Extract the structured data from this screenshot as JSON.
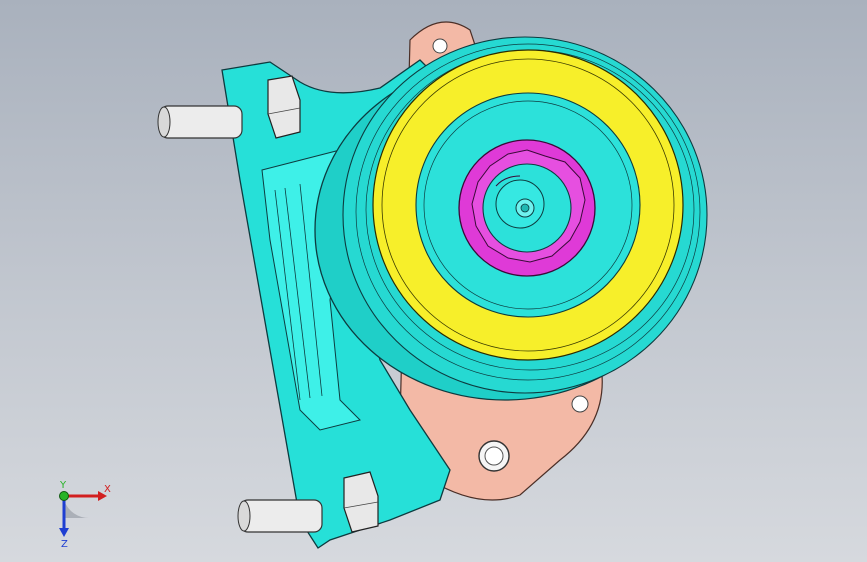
{
  "viewport": {
    "background_top": "#a9b1bd",
    "background_bottom": "#d6d9de"
  },
  "model": {
    "part_colors": {
      "housing": "#26e0d8",
      "housing_edge": "#0d3b3f",
      "mount_plate": "#f3b9a6",
      "pulley_face": "#f7ef2a",
      "pulley_rim": "#24d6cf",
      "hub": "#df3ad7",
      "bolt": "#e8e8e8"
    }
  },
  "triad": {
    "x_label": "X",
    "y_label": "Y",
    "z_label": "Z",
    "x_color": "#d21f1f",
    "y_color": "#27b327",
    "z_color": "#1f3fd2"
  }
}
